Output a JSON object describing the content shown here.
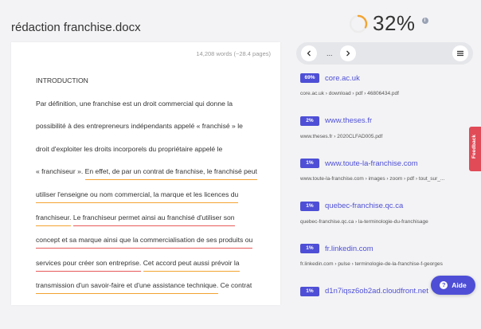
{
  "document": {
    "title": "rédaction franchise.docx",
    "word_count": "14,208 words (~28.4 pages)"
  },
  "score": {
    "value": "32%",
    "fraction": 0.32,
    "accent": "#f3a431",
    "info_icon": "i"
  },
  "body_lines": [
    [
      {
        "t": "INTRODUCTION"
      }
    ],
    [
      {
        "t": "Par définition, une franchise est un droit commercial qui donne la"
      }
    ],
    [
      {
        "t": "possibilité à des entrepreneurs indépendants appelé « franchisé » le"
      }
    ],
    [
      {
        "t": "droit d'exploiter les droits incorporels du propriétaire appelé le"
      }
    ],
    [
      {
        "t": "« franchiseur ». "
      },
      {
        "t": "En effet, de par un contrat de franchise, le franchisé peut",
        "h": "o"
      }
    ],
    [
      {
        "t": "utiliser l'enseigne ou nom commercial, la marque et les licences du",
        "h": "o"
      }
    ],
    [
      {
        "t": "franchiseur.",
        "h": "o"
      },
      {
        "t": " "
      },
      {
        "t": "Le franchiseur permet ainsi au franchisé d'utiliser son",
        "h": "r"
      }
    ],
    [
      {
        "t": "concept et sa marque ainsi que la commercialisation de ses produits ou",
        "h": "r"
      }
    ],
    [
      {
        "t": "services pour créer son entreprise.",
        "h": "r"
      },
      {
        "t": " "
      },
      {
        "t": "Cet accord peut aussi prévoir la",
        "h": "o"
      }
    ],
    [
      {
        "t": "transmission d'un savoir-faire et d'une assistance technique.",
        "h": "o"
      },
      {
        "t": " Ce contrat"
      }
    ]
  ],
  "nav": {
    "dots": "..."
  },
  "sources": [
    {
      "percent": "69%",
      "title": "core.ac.uk",
      "path": "core.ac.uk › download › pdf › 46806434.pdf"
    },
    {
      "percent": "2%",
      "title": "www.theses.fr",
      "path": "www.theses.fr › 2020CLFAD005.pdf"
    },
    {
      "percent": "1%",
      "title": "www.toute-la-franchise.com",
      "path": "www.toute-la-franchise.com › images › zoom › pdf › tout_sur_..."
    },
    {
      "percent": "1%",
      "title": "quebec-franchise.qc.ca",
      "path": "quebec-franchise.qc.ca › la-terminologie-du-franchisage"
    },
    {
      "percent": "1%",
      "title": "fr.linkedin.com",
      "path": "fr.linkedin.com › pulse › terminologie-de-la-franchise-f-georges"
    },
    {
      "percent": "1%",
      "title": "d1n7iqsz6ob2ad.cloudfront.net",
      "path": ""
    }
  ],
  "feedback": {
    "label": "Feedback"
  },
  "help": {
    "label": "Aide",
    "icon": "?"
  },
  "colors": {
    "accent": "#4e4fd6",
    "orange_underline": "#f3a431",
    "red_underline": "#e85a5a",
    "feedback_bg": "#e04b57"
  }
}
